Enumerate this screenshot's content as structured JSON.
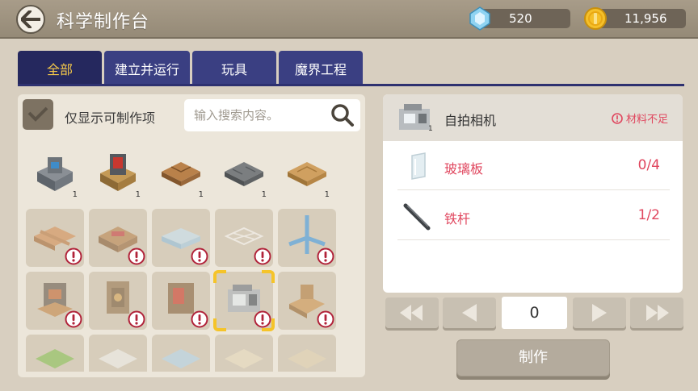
{
  "header": {
    "title": "科学制作台",
    "gems": "520",
    "coins": "11,956"
  },
  "tabs": [
    {
      "label": "全部",
      "active": true
    },
    {
      "label": "建立并运行",
      "active": false
    },
    {
      "label": "玩具",
      "active": false
    },
    {
      "label": "魔界工程",
      "active": false
    }
  ],
  "filter": {
    "label": "仅显示可制作项",
    "search_placeholder": "输入搜索内容。"
  },
  "grid": {
    "owned_counts": [
      "1",
      "1",
      "1",
      "1",
      "1"
    ]
  },
  "detail": {
    "item_name": "自拍相机",
    "item_count": "1",
    "status": "材料不足",
    "materials": [
      {
        "name": "玻璃板",
        "count": "0/4"
      },
      {
        "name": "铁杆",
        "count": "1/2"
      }
    ]
  },
  "quantity": "0",
  "make_label": "制作",
  "colors": {
    "tab_bg": "#3a3f82",
    "tab_active_text": "#f4c84a",
    "warn_red": "#e0465e",
    "selection": "#f5c42a"
  }
}
